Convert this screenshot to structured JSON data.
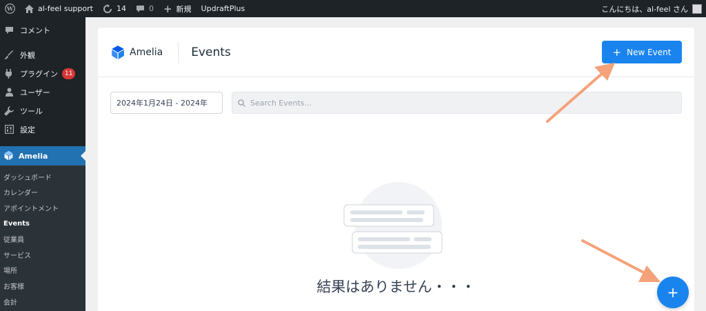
{
  "adminbar": {
    "site_name": "al-feel support",
    "updates_count": "14",
    "comments_count": "0",
    "new_label": "新規",
    "plugin_label": "UpdraftPlus",
    "greeting": "こんにちは、al-feel さん"
  },
  "sidebar": {
    "items": [
      {
        "label": "コメント",
        "icon": "comment-icon"
      },
      {
        "label": "外観",
        "icon": "brush-icon"
      },
      {
        "label": "プラグイン",
        "icon": "plugin-icon",
        "badge": "11"
      },
      {
        "label": "ユーザー",
        "icon": "user-icon"
      },
      {
        "label": "ツール",
        "icon": "wrench-icon"
      },
      {
        "label": "設定",
        "icon": "settings-icon"
      }
    ],
    "current": {
      "label": "Amelia",
      "icon": "amelia-icon"
    },
    "submenu": [
      "ダッシュボード",
      "カレンダー",
      "アポイントメント",
      "Events",
      "従業員",
      "サービス",
      "場所",
      "お客様",
      "会計"
    ],
    "current_submenu": "Events"
  },
  "header": {
    "logo_text": "Amelia",
    "title": "Events",
    "new_event_label": "New Event"
  },
  "filters": {
    "date_range": "2024年1月24日 - 2024年",
    "search_placeholder": "Search Events..."
  },
  "empty_state": {
    "message": "結果はありません・・・"
  },
  "fab": {
    "label": "+"
  },
  "colors": {
    "accent": "#1a84ee",
    "admin_dark": "#1d2327",
    "wp_blue": "#2271b1",
    "badge_red": "#d63638",
    "arrow": "#f4a27a"
  }
}
